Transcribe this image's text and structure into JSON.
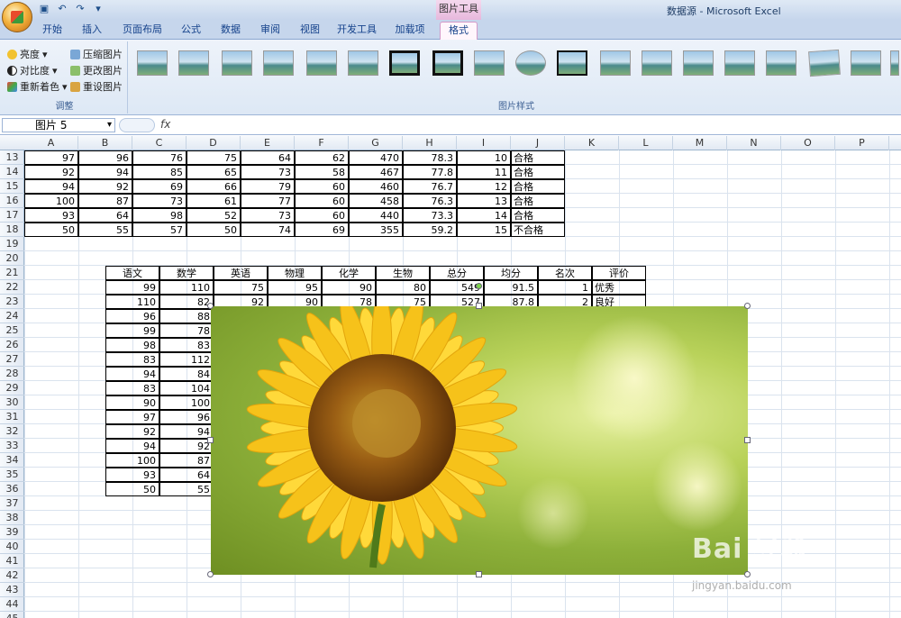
{
  "window": {
    "context_tab": "图片工具",
    "title": "数据源 - Microsoft Excel"
  },
  "ribbon": {
    "tabs": [
      "开始",
      "插入",
      "页面布局",
      "公式",
      "数据",
      "审阅",
      "视图",
      "开发工具",
      "加载项",
      "格式"
    ],
    "adjust_group": {
      "brightness": "亮度",
      "contrast": "对比度",
      "recolor": "重新着色",
      "compress": "压缩图片",
      "change": "更改图片",
      "reset": "重设图片",
      "label": "调整"
    },
    "styles_group_label": "图片样式"
  },
  "formula_bar": {
    "name_box": "图片 5",
    "fx": "fx"
  },
  "columns": [
    "A",
    "B",
    "C",
    "D",
    "E",
    "F",
    "G",
    "H",
    "I",
    "J",
    "K",
    "L",
    "M",
    "N",
    "O",
    "P"
  ],
  "rows": [
    "13",
    "14",
    "15",
    "16",
    "17",
    "18",
    "19",
    "20",
    "21",
    "22",
    "23",
    "24",
    "25",
    "26",
    "27",
    "28",
    "29",
    "30",
    "31",
    "32",
    "33",
    "34",
    "35",
    "36",
    "37",
    "38",
    "39",
    "40",
    "41",
    "42",
    "43",
    "44",
    "45",
    "46"
  ],
  "table1": [
    [
      "97",
      "96",
      "76",
      "75",
      "64",
      "62",
      "470",
      "78.3",
      "10",
      "合格"
    ],
    [
      "92",
      "94",
      "85",
      "65",
      "73",
      "58",
      "467",
      "77.8",
      "11",
      "合格"
    ],
    [
      "94",
      "92",
      "69",
      "66",
      "79",
      "60",
      "460",
      "76.7",
      "12",
      "合格"
    ],
    [
      "100",
      "87",
      "73",
      "61",
      "77",
      "60",
      "458",
      "76.3",
      "13",
      "合格"
    ],
    [
      "93",
      "64",
      "98",
      "52",
      "73",
      "60",
      "440",
      "73.3",
      "14",
      "合格"
    ],
    [
      "50",
      "55",
      "57",
      "50",
      "74",
      "69",
      "355",
      "59.2",
      "15",
      "不合格"
    ]
  ],
  "table2_headers": [
    "语文",
    "数学",
    "英语",
    "物理",
    "化学",
    "生物",
    "总分",
    "均分",
    "名次",
    "评价"
  ],
  "table2_row1": [
    "99",
    "110",
    "75",
    "95",
    "90",
    "80",
    "549",
    "91.5",
    "1",
    "优秀"
  ],
  "table2_row2": [
    "110",
    "82",
    "92",
    "90",
    "78",
    "75",
    "527",
    "87.8",
    "2",
    "良好"
  ],
  "table2_col_a": [
    "96",
    "99",
    "98",
    "83",
    "94",
    "83",
    "90",
    "97",
    "92",
    "94",
    "100",
    "93",
    "50"
  ],
  "table2_col_b": [
    "88",
    "78",
    "83",
    "112",
    "84",
    "104",
    "100",
    "96",
    "94",
    "92",
    "87",
    "64",
    "55"
  ],
  "watermark": {
    "brand": "Bai 经验",
    "url": "jingyan.baidu.com"
  }
}
